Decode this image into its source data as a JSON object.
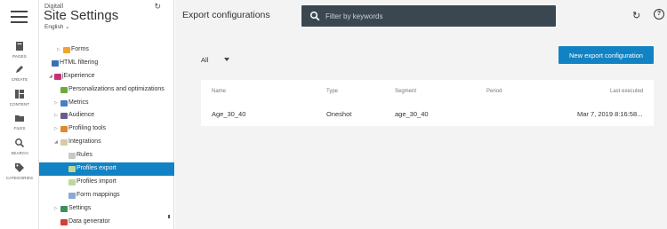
{
  "rail": {
    "items": [
      {
        "label": "PAGES",
        "icon": "pages-icon"
      },
      {
        "label": "CREATE",
        "icon": "pencil-icon"
      },
      {
        "label": "CONTENT",
        "icon": "content-grid-icon"
      },
      {
        "label": "FILES",
        "icon": "folder-icon"
      },
      {
        "label": "SEARCH",
        "icon": "search-icon"
      },
      {
        "label": "CATEGORIES",
        "icon": "tag-icon"
      }
    ]
  },
  "site": {
    "name_small": "Digitall",
    "title": "Site Settings",
    "language": "English"
  },
  "tree": [
    {
      "label": "Forms",
      "expander": "▷",
      "icon_color": "#f2a22d"
    },
    {
      "label": "HTML filtering",
      "expander": "",
      "icon_color": "#3a6fb8"
    },
    {
      "label": "jExperience",
      "expander": "◢",
      "icon_color": "#c8307a"
    },
    {
      "label": "Personalizations and optimizations",
      "expander": "",
      "icon_color": "#6cab3a"
    },
    {
      "label": "Metrics",
      "expander": "▷",
      "icon_color": "#4a7cc8"
    },
    {
      "label": "Audience",
      "expander": "▷",
      "icon_color": "#6a5b8f"
    },
    {
      "label": "Profiling tools",
      "expander": "▷",
      "icon_color": "#e08a2a"
    },
    {
      "label": "Integrations",
      "expander": "◢",
      "icon_color": "#d8c9a8"
    },
    {
      "label": "Rules",
      "expander": "",
      "icon_color": "#c8c8c8"
    },
    {
      "label": "Profiles export",
      "expander": "",
      "icon_color": "#bcd99a"
    },
    {
      "label": "Profiles import",
      "expander": "",
      "icon_color": "#bcd99a"
    },
    {
      "label": "Form mappings",
      "expander": "",
      "icon_color": "#8aa9d6"
    },
    {
      "label": "Settings",
      "expander": "▷",
      "icon_color": "#3d8f5a"
    },
    {
      "label": "Data generator",
      "expander": "",
      "icon_color": "#d2403a"
    }
  ],
  "header": {
    "title": "Export configurations",
    "search_placeholder": "Filter by keywords"
  },
  "filter": {
    "selected": "All"
  },
  "new_button": "New export configuration",
  "table": {
    "columns": [
      "Name",
      "Type",
      "Segment",
      "Period",
      "Last executed"
    ],
    "rows": [
      {
        "name": "Age_30_40",
        "type": "Oneshot",
        "segment": "age_30_40",
        "period": "",
        "last_executed": "Mar 7, 2019 8:16:58..."
      }
    ]
  }
}
